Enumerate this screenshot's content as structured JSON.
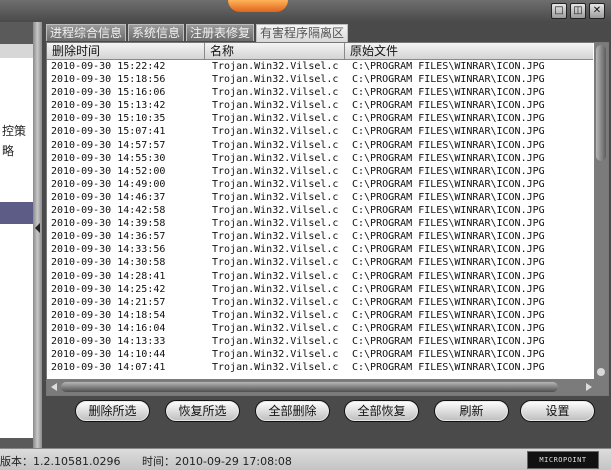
{
  "window": {
    "controls": [
      "□",
      "◫",
      "✕"
    ]
  },
  "left_pane": {
    "fragments": [
      "控策",
      "略"
    ]
  },
  "tabs": [
    {
      "label": "进程综合信息",
      "active": false
    },
    {
      "label": "系统信息",
      "active": false
    },
    {
      "label": "注册表修复",
      "active": false
    },
    {
      "label": "有害程序隔离区",
      "active": true
    }
  ],
  "table": {
    "columns": [
      "删除时间",
      "名称",
      "原始文件"
    ],
    "rows": [
      [
        "2010-09-30 15:22:42",
        "Trojan.Win32.Vilsel.c",
        "C:\\PROGRAM FILES\\WINRAR\\ICON.JPG"
      ],
      [
        "2010-09-30 15:18:56",
        "Trojan.Win32.Vilsel.c",
        "C:\\PROGRAM FILES\\WINRAR\\ICON.JPG"
      ],
      [
        "2010-09-30 15:16:06",
        "Trojan.Win32.Vilsel.c",
        "C:\\PROGRAM FILES\\WINRAR\\ICON.JPG"
      ],
      [
        "2010-09-30 15:13:42",
        "Trojan.Win32.Vilsel.c",
        "C:\\PROGRAM FILES\\WINRAR\\ICON.JPG"
      ],
      [
        "2010-09-30 15:10:35",
        "Trojan.Win32.Vilsel.c",
        "C:\\PROGRAM FILES\\WINRAR\\ICON.JPG"
      ],
      [
        "2010-09-30 15:07:41",
        "Trojan.Win32.Vilsel.c",
        "C:\\PROGRAM FILES\\WINRAR\\ICON.JPG"
      ],
      [
        "2010-09-30 14:57:57",
        "Trojan.Win32.Vilsel.c",
        "C:\\PROGRAM FILES\\WINRAR\\ICON.JPG"
      ],
      [
        "2010-09-30 14:55:30",
        "Trojan.Win32.Vilsel.c",
        "C:\\PROGRAM FILES\\WINRAR\\ICON.JPG"
      ],
      [
        "2010-09-30 14:52:00",
        "Trojan.Win32.Vilsel.c",
        "C:\\PROGRAM FILES\\WINRAR\\ICON.JPG"
      ],
      [
        "2010-09-30 14:49:00",
        "Trojan.Win32.Vilsel.c",
        "C:\\PROGRAM FILES\\WINRAR\\ICON.JPG"
      ],
      [
        "2010-09-30 14:46:37",
        "Trojan.Win32.Vilsel.c",
        "C:\\PROGRAM FILES\\WINRAR\\ICON.JPG"
      ],
      [
        "2010-09-30 14:42:58",
        "Trojan.Win32.Vilsel.c",
        "C:\\PROGRAM FILES\\WINRAR\\ICON.JPG"
      ],
      [
        "2010-09-30 14:39:58",
        "Trojan.Win32.Vilsel.c",
        "C:\\PROGRAM FILES\\WINRAR\\ICON.JPG"
      ],
      [
        "2010-09-30 14:36:57",
        "Trojan.Win32.Vilsel.c",
        "C:\\PROGRAM FILES\\WINRAR\\ICON.JPG"
      ],
      [
        "2010-09-30 14:33:56",
        "Trojan.Win32.Vilsel.c",
        "C:\\PROGRAM FILES\\WINRAR\\ICON.JPG"
      ],
      [
        "2010-09-30 14:30:58",
        "Trojan.Win32.Vilsel.c",
        "C:\\PROGRAM FILES\\WINRAR\\ICON.JPG"
      ],
      [
        "2010-09-30 14:28:41",
        "Trojan.Win32.Vilsel.c",
        "C:\\PROGRAM FILES\\WINRAR\\ICON.JPG"
      ],
      [
        "2010-09-30 14:25:42",
        "Trojan.Win32.Vilsel.c",
        "C:\\PROGRAM FILES\\WINRAR\\ICON.JPG"
      ],
      [
        "2010-09-30 14:21:57",
        "Trojan.Win32.Vilsel.c",
        "C:\\PROGRAM FILES\\WINRAR\\ICON.JPG"
      ],
      [
        "2010-09-30 14:18:54",
        "Trojan.Win32.Vilsel.c",
        "C:\\PROGRAM FILES\\WINRAR\\ICON.JPG"
      ],
      [
        "2010-09-30 14:16:04",
        "Trojan.Win32.Vilsel.c",
        "C:\\PROGRAM FILES\\WINRAR\\ICON.JPG"
      ],
      [
        "2010-09-30 14:13:33",
        "Trojan.Win32.Vilsel.c",
        "C:\\PROGRAM FILES\\WINRAR\\ICON.JPG"
      ],
      [
        "2010-09-30 14:10:44",
        "Trojan.Win32.Vilsel.c",
        "C:\\PROGRAM FILES\\WINRAR\\ICON.JPG"
      ],
      [
        "2010-09-30 14:07:41",
        "Trojan.Win32.Vilsel.c",
        "C:\\PROGRAM FILES\\WINRAR\\ICON.JPG"
      ]
    ]
  },
  "buttons": [
    "删除所选",
    "恢复所选",
    "全部删除",
    "全部恢复",
    "刷新",
    "设置"
  ],
  "status": {
    "version": "版本：1.2.10581.0296",
    "time": "时间：2010-09-29 17:08:08",
    "logo": "MICROPOINT"
  }
}
